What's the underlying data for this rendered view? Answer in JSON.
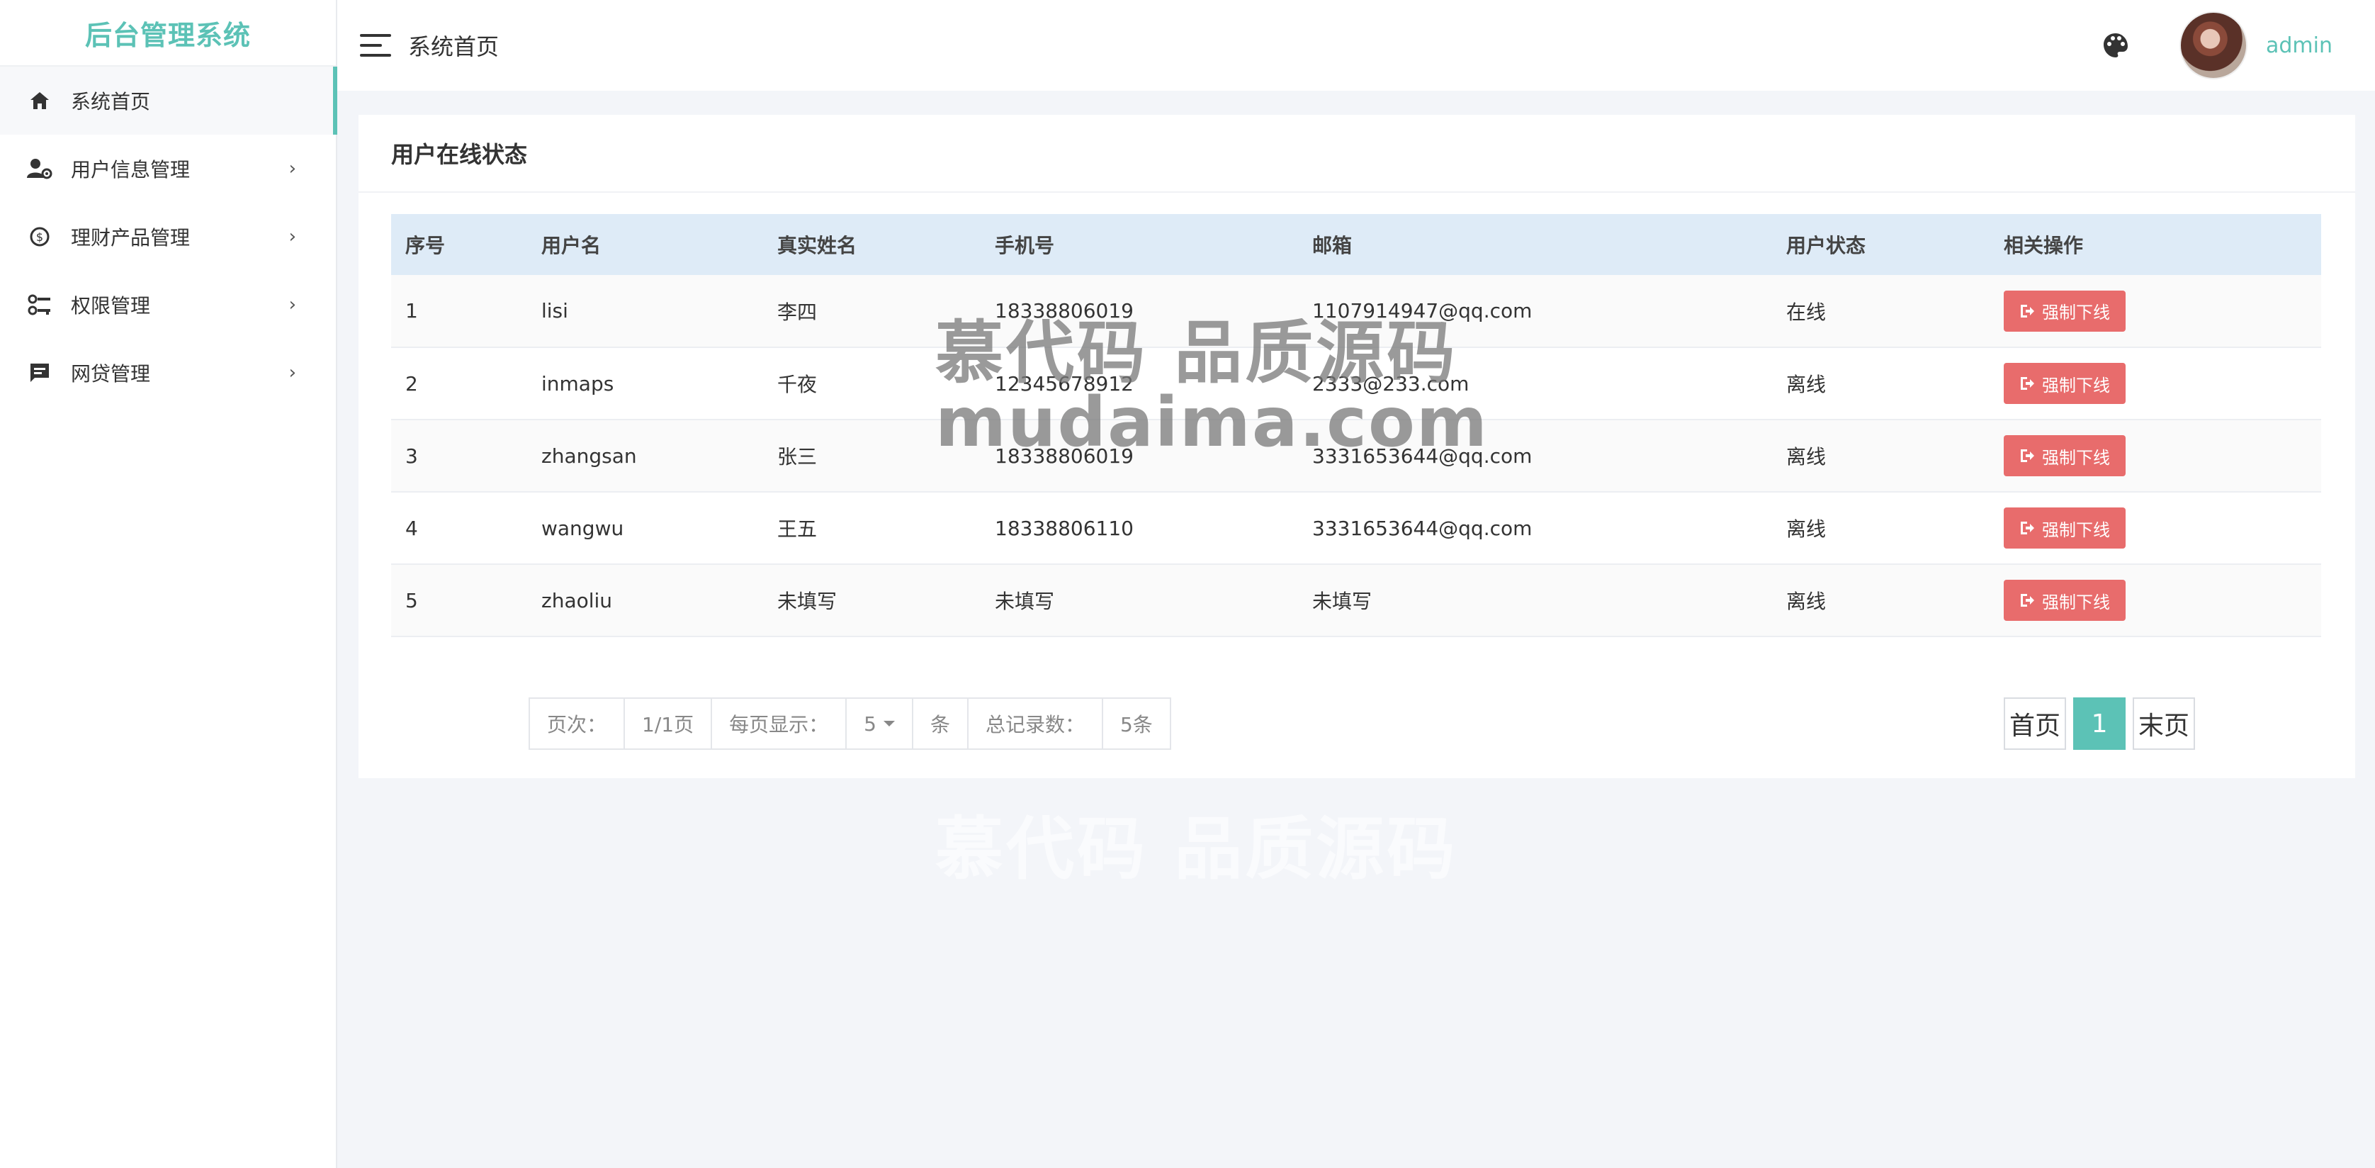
{
  "brand": "后台管理系统",
  "sidebar": {
    "items": [
      {
        "label": "系统首页",
        "icon": "home-icon",
        "has_children": false
      },
      {
        "label": "用户信息管理",
        "icon": "user-gear-icon",
        "has_children": true
      },
      {
        "label": "理财产品管理",
        "icon": "coin-icon",
        "has_children": true
      },
      {
        "label": "权限管理",
        "icon": "key-icon",
        "has_children": true
      },
      {
        "label": "网贷管理",
        "icon": "message-icon",
        "has_children": true
      }
    ],
    "chevron": "›"
  },
  "header": {
    "title": "系统首页",
    "user": "admin"
  },
  "panel": {
    "title": "用户在线状态",
    "columns": [
      "序号",
      "用户名",
      "真实姓名",
      "手机号",
      "邮箱",
      "用户状态",
      "相关操作"
    ],
    "rows": [
      {
        "index": "1",
        "username": "lisi",
        "realname": "李四",
        "phone": "18338806019",
        "email": "1107914947@qq.com",
        "status": "在线"
      },
      {
        "index": "2",
        "username": "inmaps",
        "realname": "千夜",
        "phone": "12345678912",
        "email": "2333@233.com",
        "status": "离线"
      },
      {
        "index": "3",
        "username": "zhangsan",
        "realname": "张三",
        "phone": "18338806019",
        "email": "3331653644@qq.com",
        "status": "离线"
      },
      {
        "index": "4",
        "username": "wangwu",
        "realname": "王五",
        "phone": "18338806110",
        "email": "3331653644@qq.com",
        "status": "离线"
      },
      {
        "index": "5",
        "username": "zhaoliu",
        "realname": "未填写",
        "phone": "未填写",
        "email": "未填写",
        "status": "离线"
      }
    ],
    "action_label": "强制下线"
  },
  "pagination": {
    "page_label": "页次：",
    "page_value": "1/1页",
    "per_page_label": "每页显示：",
    "per_page_value": "5",
    "per_page_unit": "条",
    "total_label": "总记录数：",
    "total_value": "5条",
    "first": "首页",
    "current": "1",
    "last": "末页"
  },
  "watermark": {
    "line1": "慕代码 品质源码",
    "line2": "mudaima.com"
  },
  "colors": {
    "accent": "#5cc2b6",
    "danger": "#e86c6c",
    "table_header": "#deebf7"
  }
}
